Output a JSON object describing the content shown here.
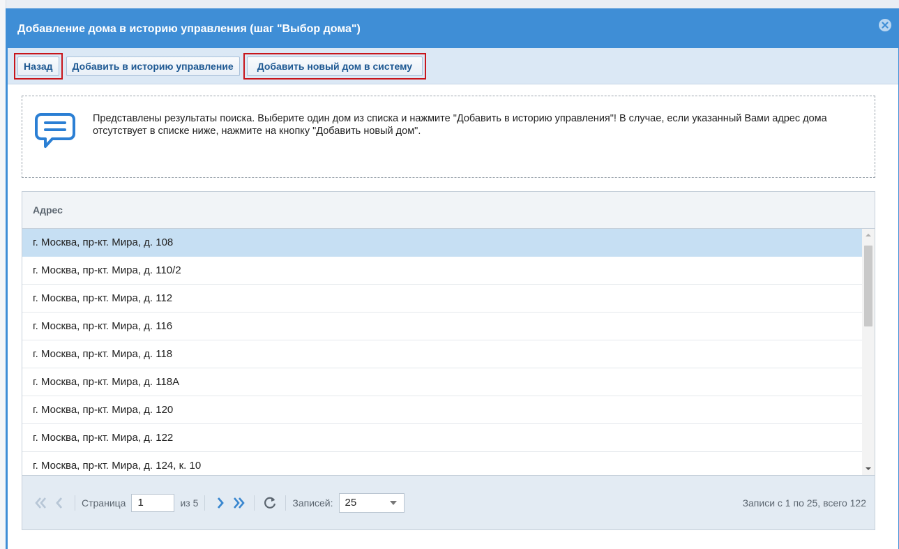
{
  "window": {
    "title": "Добавление дома в историю управления (шаг \"Выбор дома\")"
  },
  "toolbar": {
    "back_label": "Назад",
    "add_history_label": "Добавить в историю управление",
    "add_new_house_label": "Добавить новый дом в систему"
  },
  "info": {
    "icon": "chat-bubble-icon",
    "text": "Представлены результаты поиска. Выберите один дом из списка и нажмите \"Добавить в историю управления\"! В случае, если указанный Вами адрес дома отсутствует в списке ниже, нажмите на кнопку \"Добавить новый дом\"."
  },
  "grid": {
    "column_header": "Адрес",
    "rows": [
      "г. Москва, пр-кт. Мира, д. 108",
      "г. Москва, пр-кт. Мира, д. 110/2",
      "г. Москва, пр-кт. Мира, д. 112",
      "г. Москва, пр-кт. Мира, д. 116",
      "г. Москва, пр-кт. Мира, д. 118",
      "г. Москва, пр-кт. Мира, д. 118А",
      "г. Москва, пр-кт. Мира, д. 120",
      "г. Москва, пр-кт. Мира, д. 122",
      "г. Москва, пр-кт. Мира, д. 124, к. 10"
    ],
    "selected_index": 0
  },
  "pager": {
    "page_label": "Страница",
    "page_value": "1",
    "of_label": "из 5",
    "records_label": "Записей:",
    "records_value": "25",
    "summary": "Записи с 1 по 25, всего 122"
  },
  "colors": {
    "accent": "#3f8ed6",
    "highlight_border": "#c8151b",
    "selected_row": "#c6dff3"
  }
}
